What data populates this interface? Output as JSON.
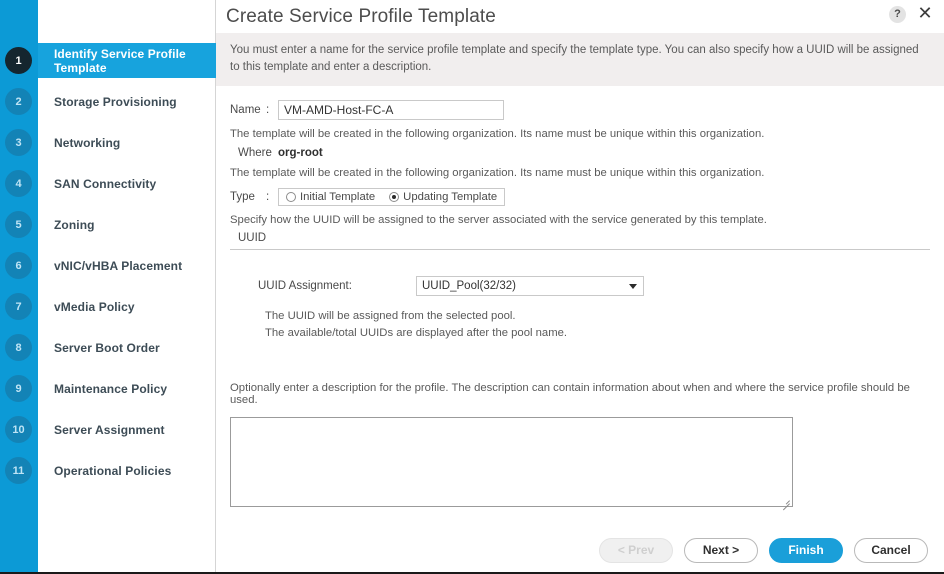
{
  "dialog": {
    "title": "Create Service Profile Template",
    "help_icon": "?",
    "close_icon": "✕",
    "banner": "You must enter a name for the service profile template and specify the template type. You can also specify how a UUID will be assigned to this template and enter a description."
  },
  "sidebar": {
    "items": [
      {
        "number": "1",
        "label": "Identify Service Profile Template"
      },
      {
        "number": "2",
        "label": "Storage Provisioning"
      },
      {
        "number": "3",
        "label": "Networking"
      },
      {
        "number": "4",
        "label": "SAN Connectivity"
      },
      {
        "number": "5",
        "label": "Zoning"
      },
      {
        "number": "6",
        "label": "vNIC/vHBA Placement"
      },
      {
        "number": "7",
        "label": "vMedia Policy"
      },
      {
        "number": "8",
        "label": "Server Boot Order"
      },
      {
        "number": "9",
        "label": "Maintenance Policy"
      },
      {
        "number": "10",
        "label": "Server Assignment"
      },
      {
        "number": "11",
        "label": "Operational Policies"
      }
    ]
  },
  "form": {
    "name_label": "Name",
    "name_colon": ":",
    "name_value": "VM-AMD-Host-FC-A",
    "name_placeholder": "",
    "org_note_1": "The template will be created in the following organization. Its name must be unique within this organization.",
    "where_label": "Where",
    "where_colon": ":",
    "where_value": "org-root",
    "org_note_2": "The template will be created in the following organization. Its name must be unique within this organization.",
    "type_label": "Type",
    "type_colon": ":",
    "type_options": [
      {
        "label": "Initial Template",
        "checked": false
      },
      {
        "label": "Updating Template",
        "checked": true
      }
    ],
    "uuid_note": "Specify how the UUID will be assigned to the server associated with the service generated by this template.",
    "uuid_section": "UUID",
    "uuid_assignment_label": "UUID Assignment:",
    "uuid_assignment_value": "UUID_Pool(32/32)",
    "uuid_help_line_1": "The UUID will be assigned from the selected pool.",
    "uuid_help_line_2": "The available/total UUIDs are displayed after the pool name.",
    "description_note": "Optionally enter a description for the profile. The description can contain information about when and where the service profile should be used.",
    "description_value": "",
    "description_placeholder": ""
  },
  "footer": {
    "prev_label": "< Prev",
    "next_label": "Next >",
    "finish_label": "Finish",
    "cancel_label": "Cancel"
  },
  "colors": {
    "rail_blue": "#0c9ad6",
    "active_blue": "#17a3dd",
    "primary_blue": "#1a9fd9",
    "badge_blue": "#1383b6",
    "badge_active": "#15262f",
    "banner_gray": "#f1eeee"
  }
}
